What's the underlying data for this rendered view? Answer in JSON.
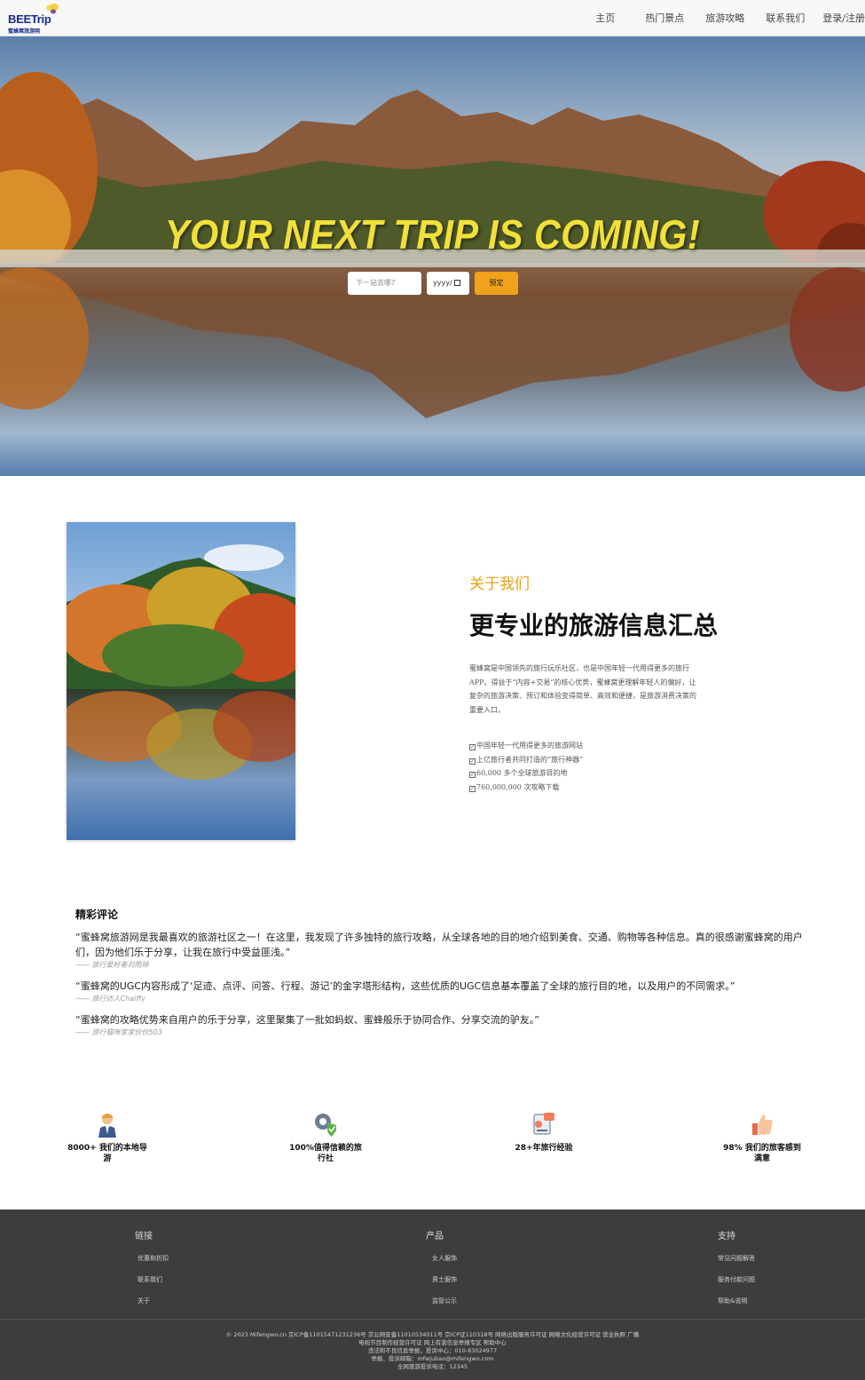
{
  "nav": {
    "logo_text": "BEETrip",
    "logo_sub": "蜜蜂窝旅游网",
    "items": [
      "主页",
      "热门景点",
      "旅游攻略",
      "联系我们",
      "登录/注册"
    ]
  },
  "hero": {
    "title": "YOUR NEXT TRIP IS COMING!",
    "search_placeholder": "下一站去哪?",
    "date_placeholder": "yyyy/",
    "book_label": "预定"
  },
  "about": {
    "kicker": "关于我们",
    "title": "更专业的旅游信息汇总",
    "description": "蜜蜂窝是中国领先的旅行玩乐社区，也是中国年轻一代用得更多的旅行APP。得益于“内容+交易”的核心优势，蜜蜂窝更理解年轻人的偏好，让复杂的旅游决策、预订和体验变得简单、高效和便捷，是旅游消费决策的重要入口。",
    "features": [
      "中国年轻一代用得更多的旅游网站",
      "上亿旅行者共同打造的“旅行神器”",
      "60,000 多个全球旅游目的地",
      "760,000,000 次攻略下载"
    ]
  },
  "reviews": {
    "title": "精彩评论",
    "items": [
      {
        "quote": "“蜜蜂窝旅游网是我最喜欢的旅游社区之一！在这里，我发现了许多独特的旅行攻略，从全球各地的目的地介绍到美食、交通、购物等各种信息。真的很感谢蜜蜂窝的用户们，因为他们乐于分享，让我在旅行中受益匪浅。”",
        "author": "—— 旅行爱好者刘雨婷"
      },
      {
        "quote": "“蜜蜂窝的UGC内容形成了‘足迹、点评、问答、行程、游记’的金字塔形结构，这些优质的UGC信息基本覆盖了全球的旅行目的地，以及用户的不同需求。”",
        "author": "—— 旅行达人Chaiffy"
      },
      {
        "quote": "“蜜蜂窝的攻略优势来自用户的乐于分享，这里聚集了一批如蚂蚁、蜜蜂般乐于协同合作、分享交流的驴友。”",
        "author": "—— 旅行猫咪家家伙伙503"
      }
    ]
  },
  "stats": [
    {
      "icon": "guide-icon",
      "label": "8000+ 我们的本地导游"
    },
    {
      "icon": "shield-gear-icon",
      "label": "100%值得信赖的旅行社"
    },
    {
      "icon": "experience-icon",
      "label": "28+年旅行经验"
    },
    {
      "icon": "thumbs-up-icon",
      "label": "98% 我们的旅客感到满意"
    }
  ],
  "footer": {
    "columns": [
      {
        "title": "链接",
        "links": [
          "优惠和折扣",
          "联系我们",
          "关于"
        ]
      },
      {
        "title": "产品",
        "links": [
          "女人服饰",
          "男士服饰",
          "监管公示"
        ]
      },
      {
        "title": "支持",
        "links": [
          "常见问题解答",
          "服务付款问题",
          "帮助&说明"
        ]
      }
    ],
    "legal": [
      "© 2023 Mifengwo.cn 京ICP备11015471231236号 京公网安备11010534011号 京ICP证110318号 网络出版服务许可证 网络文化经营许可证 营业执照 广播",
      "电视节目制作经营许可证 网上有害信息举报专区 帮助中心",
      "违法和不良信息举报，投诉中心：010-83024977",
      "举报、投诉邮箱：mfwjubao@mifengwo.com",
      "全网旅游投诉电话：12345"
    ]
  },
  "colors": {
    "accent": "#e9a218",
    "button": "#f0a21c",
    "hero_title": "#f2e03a",
    "footer_bg": "#3d3d3d",
    "logo": "#1c2a8a"
  }
}
